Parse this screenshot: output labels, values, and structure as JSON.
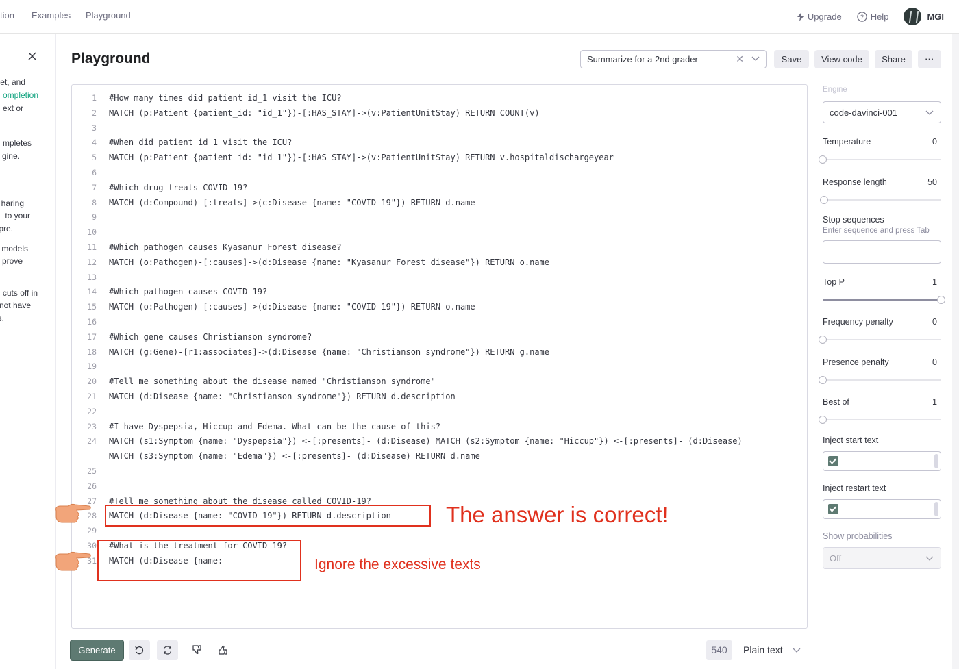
{
  "nav": {
    "items": [
      "tion",
      "Examples",
      "Playground"
    ],
    "upgrade": "Upgrade",
    "help": "Help",
    "org": "MGI"
  },
  "left_panel": {
    "lines": [
      "et, and",
      "ompletion",
      "ext or",
      "mpletes",
      "gine.",
      "haring",
      "to your",
      "pre.",
      "models",
      "prove",
      "cuts off in",
      "not have",
      "s."
    ]
  },
  "header": {
    "title": "Playground",
    "preset": "Summarize for a 2nd grader",
    "save": "Save",
    "view_code": "View code",
    "share": "Share",
    "more": "···"
  },
  "editor": {
    "lines": [
      {
        "n": "1",
        "text": "#How many times did patient id_1 visit the ICU?"
      },
      {
        "n": "2",
        "text": "MATCH (p:Patient {patient_id: \"id_1\"})-[:HAS_STAY]->(v:PatientUnitStay) RETURN COUNT(v)"
      },
      {
        "n": "3",
        "text": ""
      },
      {
        "n": "4",
        "text": "#When did patient id_1 visit the ICU?"
      },
      {
        "n": "5",
        "text": "MATCH (p:Patient {patient_id: \"id_1\"})-[:HAS_STAY]->(v:PatientUnitStay) RETURN v.hospitaldischargeyear"
      },
      {
        "n": "6",
        "text": ""
      },
      {
        "n": "7",
        "text": "#Which drug treats COVID-19?"
      },
      {
        "n": "8",
        "text": "MATCH (d:Compound)-[:treats]->(c:Disease {name: \"COVID-19\"}) RETURN d.name"
      },
      {
        "n": "9",
        "text": ""
      },
      {
        "n": "10",
        "text": ""
      },
      {
        "n": "11",
        "text": "#Which pathogen causes Kyasanur Forest disease?"
      },
      {
        "n": "12",
        "text": "MATCH (o:Pathogen)-[:causes]->(d:Disease {name: \"Kyasanur Forest disease\"}) RETURN o.name"
      },
      {
        "n": "13",
        "text": ""
      },
      {
        "n": "14",
        "text": "#Which pathogen causes COVID-19?"
      },
      {
        "n": "15",
        "text": "MATCH (o:Pathogen)-[:causes]->(d:Disease {name: \"COVID-19\"}) RETURN o.name"
      },
      {
        "n": "16",
        "text": ""
      },
      {
        "n": "17",
        "text": "#Which gene causes Christianson syndrome?"
      },
      {
        "n": "18",
        "text": "MATCH (g:Gene)-[r1:associates]->(d:Disease {name: \"Christianson syndrome\"}) RETURN g.name"
      },
      {
        "n": "19",
        "text": ""
      },
      {
        "n": "20",
        "text": "#Tell me something about the disease named \"Christianson syndrome\""
      },
      {
        "n": "21",
        "text": "MATCH (d:Disease {name: \"Christianson syndrome\"}) RETURN d.description"
      },
      {
        "n": "22",
        "text": ""
      },
      {
        "n": "23",
        "text": "#I have Dyspepsia, Hiccup and Edema. What can be the cause of this?"
      },
      {
        "n": "24",
        "text": "MATCH (s1:Symptom {name: \"Dyspepsia\"}) <-[:presents]- (d:Disease) MATCH (s2:Symptom {name: \"Hiccup\"}) <-[:presents]- (d:Disease)"
      },
      {
        "n": "",
        "text": "MATCH (s3:Symptom {name: \"Edema\"}) <-[:presents]- (d:Disease) RETURN d.name"
      },
      {
        "n": "25",
        "text": ""
      },
      {
        "n": "26",
        "text": ""
      },
      {
        "n": "27",
        "text": "#Tell me something about the disease called COVID-19?"
      },
      {
        "n": "28",
        "text": "MATCH (d:Disease {name: \"COVID-19\"}) RETURN d.description"
      },
      {
        "n": "29",
        "text": ""
      },
      {
        "n": "30",
        "text": "#What is the treatment for COVID-19?"
      },
      {
        "n": "31",
        "text": "MATCH (d:Disease {name:"
      }
    ]
  },
  "annotations": {
    "correct": "The answer is correct!",
    "ignore": "Ignore the excessive texts",
    "color": "#e0311e"
  },
  "settings": {
    "engine_label": "Engine",
    "engine": "code-davinci-001",
    "temperature": {
      "label": "Temperature",
      "value": "0",
      "fraction": 0
    },
    "response_length": {
      "label": "Response length",
      "value": "50",
      "fraction": 0.01
    },
    "stop": {
      "label": "Stop sequences",
      "hint": "Enter sequence and press Tab"
    },
    "top_p": {
      "label": "Top P",
      "value": "1",
      "fraction": 1
    },
    "frequency_penalty": {
      "label": "Frequency penalty",
      "value": "0",
      "fraction": 0
    },
    "presence_penalty": {
      "label": "Presence penalty",
      "value": "0",
      "fraction": 0
    },
    "best_of": {
      "label": "Best of",
      "value": "1",
      "fraction": 0
    },
    "inject_start": {
      "label": "Inject start text",
      "checked": true
    },
    "inject_restart": {
      "label": "Inject restart text",
      "checked": true
    },
    "show_probabilities": {
      "label": "Show probabilities",
      "value": "Off"
    }
  },
  "footer": {
    "generate": "Generate",
    "token_count": "540",
    "format": "Plain text"
  },
  "colors": {
    "accent": "#5e7a72",
    "annotation": "#e0311e"
  }
}
